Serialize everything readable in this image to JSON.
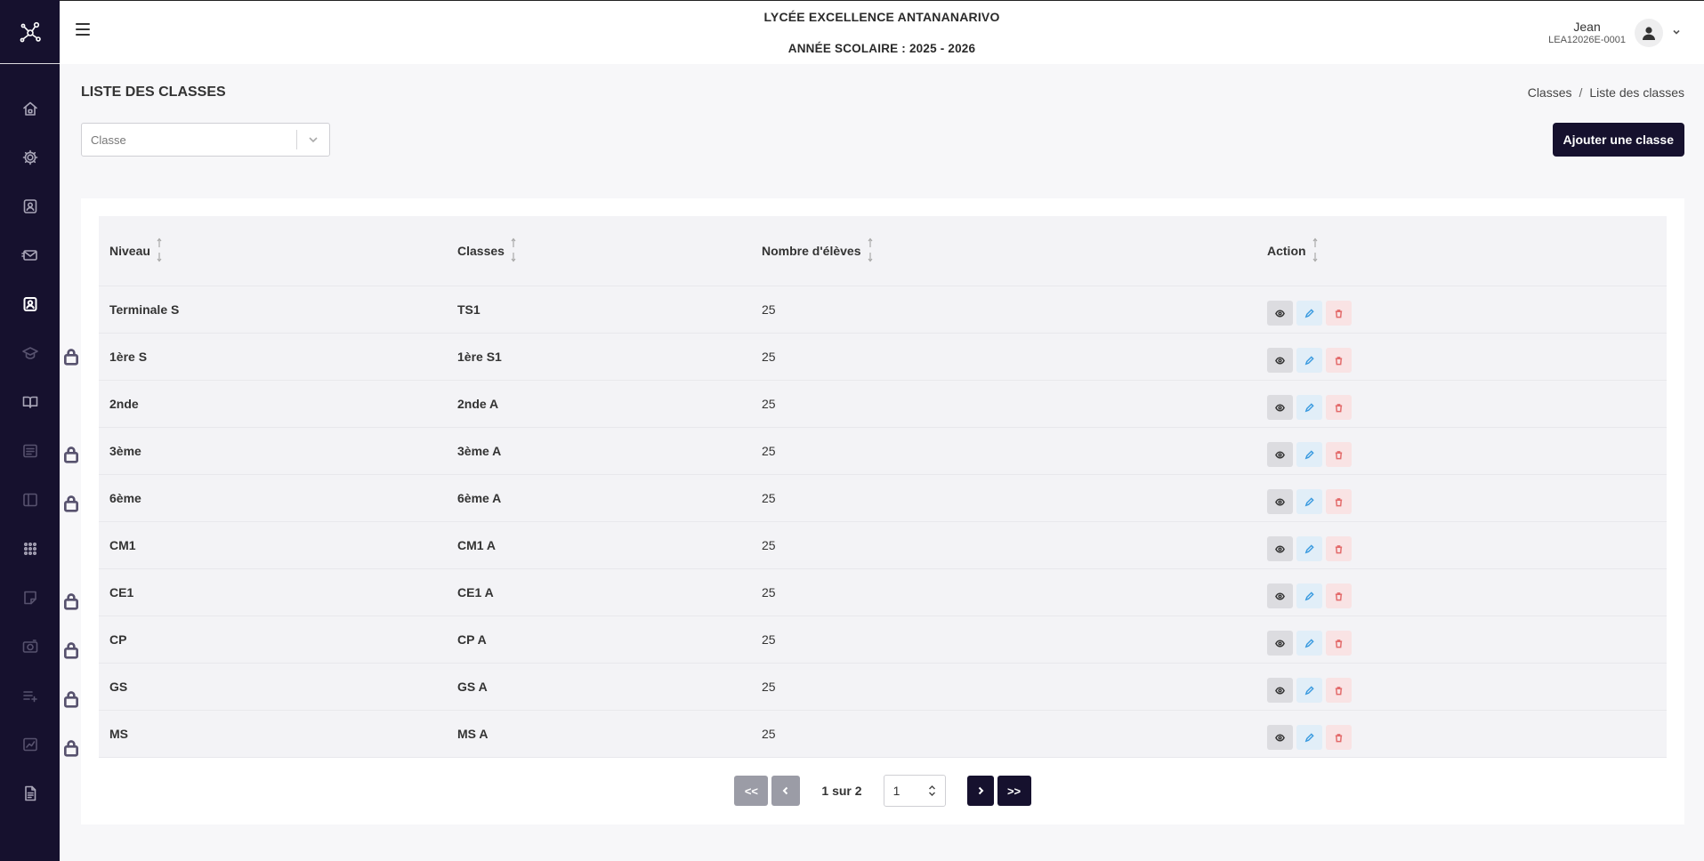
{
  "header": {
    "school_name": "LYCÉE EXCELLENCE ANTANANARIVO",
    "school_year": "ANNÉE SCOLAIRE : 2025 - 2026",
    "user_name": "Jean",
    "user_id": "LEA12026E-0001"
  },
  "sidebar": {
    "items": [
      {
        "icon": "home-icon",
        "locked": false
      },
      {
        "icon": "gear-icon",
        "locked": false
      },
      {
        "icon": "id-badge-icon",
        "locked": false
      },
      {
        "icon": "mail-icon",
        "locked": false
      },
      {
        "icon": "user-square-icon",
        "locked": false,
        "active": true
      },
      {
        "icon": "graduation-cap-icon",
        "locked": true
      },
      {
        "icon": "book-open-icon",
        "locked": false
      },
      {
        "icon": "document-lines-icon",
        "locked": true
      },
      {
        "icon": "sidebar-panel-icon",
        "locked": true
      },
      {
        "icon": "grid-icon",
        "locked": false
      },
      {
        "icon": "note-icon",
        "locked": true
      },
      {
        "icon": "camera-icon",
        "locked": true
      },
      {
        "icon": "list-add-icon",
        "locked": true
      },
      {
        "icon": "chart-line-icon",
        "locked": true
      },
      {
        "icon": "file-text-icon",
        "locked": false
      }
    ]
  },
  "page": {
    "title": "LISTE DES CLASSES",
    "breadcrumb": [
      "Classes",
      "Liste des classes"
    ],
    "breadcrumb_sep": "/",
    "select_placeholder": "Classe",
    "add_button": "Ajouter une classe"
  },
  "table": {
    "columns": [
      "Niveau",
      "Classes",
      "Nombre d'élèves",
      "Action"
    ],
    "rows": [
      {
        "niveau": "Terminale S",
        "classe": "TS1",
        "eleves": "25"
      },
      {
        "niveau": "1ère S",
        "classe": "1ère S1",
        "eleves": "25"
      },
      {
        "niveau": "2nde",
        "classe": "2nde A",
        "eleves": "25"
      },
      {
        "niveau": "3ème",
        "classe": "3ème A",
        "eleves": "25"
      },
      {
        "niveau": "6ème",
        "classe": "6ème A",
        "eleves": "25"
      },
      {
        "niveau": "CM1",
        "classe": "CM1 A",
        "eleves": "25"
      },
      {
        "niveau": "CE1",
        "classe": "CE1 A",
        "eleves": "25"
      },
      {
        "niveau": "CP",
        "classe": "CP A",
        "eleves": "25"
      },
      {
        "niveau": "GS",
        "classe": "GS A",
        "eleves": "25"
      },
      {
        "niveau": "MS",
        "classe": "MS A",
        "eleves": "25"
      }
    ]
  },
  "pagination": {
    "first_label": "<<",
    "last_label": ">>",
    "info": "1 sur 2",
    "page_value": "1"
  },
  "colors": {
    "sidebar_bg": "#16112e",
    "primary": "#16112e",
    "edit": "#3b9be0",
    "delete": "#e36a6a"
  }
}
